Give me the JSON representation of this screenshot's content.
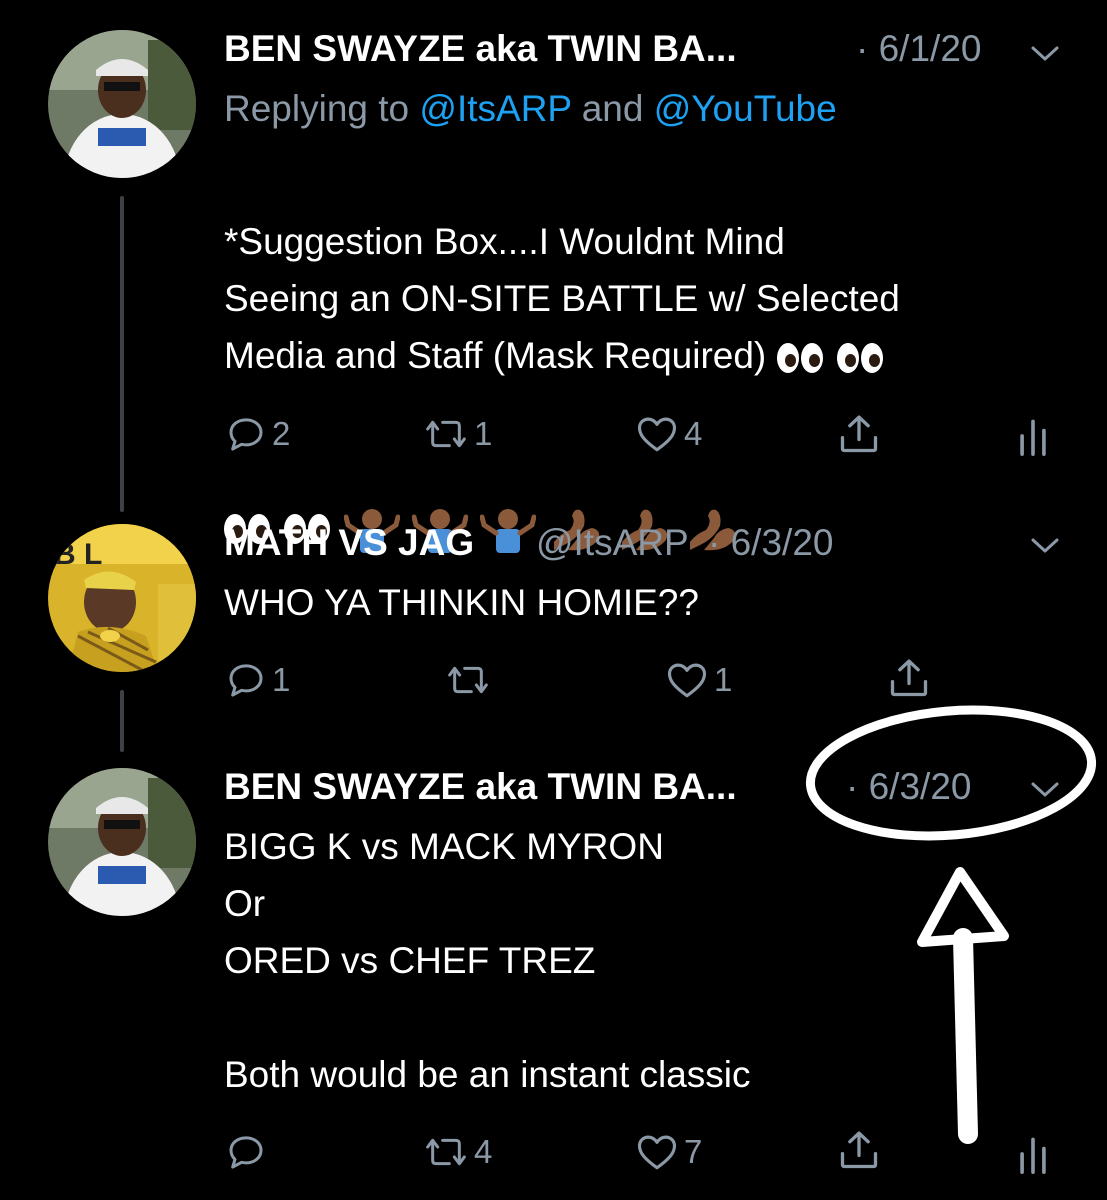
{
  "tweets": [
    {
      "name": "BEN SWAYZE aka TWIN BA...",
      "handle": "",
      "date": "· 6/1/20",
      "reply_prefix": "Replying to ",
      "reply_mention_1": "@ItsARP",
      "reply_and": " and ",
      "reply_mention_2": "@YouTube",
      "text": "*Suggestion Box....I Wouldnt Mind\nSeeing an ON-SITE BATTLE w/ Selected\nMedia and Staff (Mask Required) ",
      "emoji": [
        "eyes",
        "eyes",
        "eyes",
        "eyes",
        "shrug",
        "shrug",
        "shrug",
        "flexed-biceps",
        "flexed-biceps",
        "flexed-biceps"
      ],
      "replies": "2",
      "retweets": "1",
      "likes": "4"
    },
    {
      "name": "MATH VS JAG",
      "handle": "@ItsARP",
      "date": "· 6/3/20",
      "text": "WHO YA THINKIN HOMIE??",
      "replies": "1",
      "retweets": "",
      "likes": "1"
    },
    {
      "name": "BEN SWAYZE aka TWIN BA...",
      "handle": "",
      "date": "· 6/3/20",
      "text": "BIGG K vs MACK MYRON\nOr\nORED vs CHEF TREZ\n\nBoth would be an instant classic",
      "replies": "",
      "retweets": "4",
      "likes": "7"
    }
  ],
  "icons": {
    "reply": "reply-icon",
    "retweet": "retweet-icon",
    "like": "heart-icon",
    "share": "share-icon",
    "analytics": "analytics-icon",
    "more": "chevron-down-icon"
  },
  "colors": {
    "background": "#000000",
    "text": "#ffffff",
    "muted": "#8b98a5",
    "link": "#1da1f2",
    "annotation": "#ffffff"
  }
}
